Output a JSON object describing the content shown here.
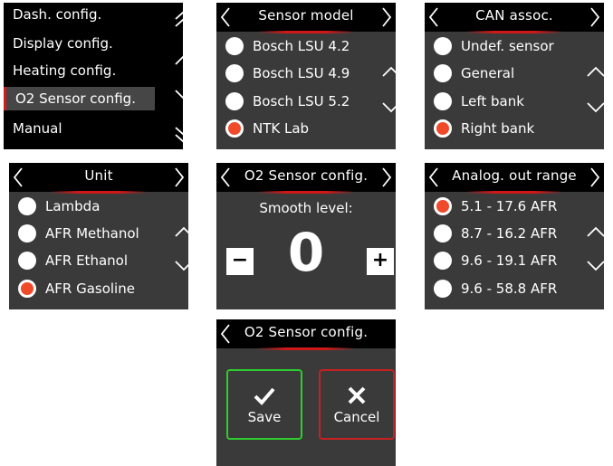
{
  "menu": {
    "items": [
      "Dash. config.",
      "Display config.",
      "Heating config.",
      "O2 Sensor config.",
      "Manual"
    ]
  },
  "sensor_model": {
    "title": "Sensor model",
    "options": [
      "Bosch LSU 4.2",
      "Bosch LSU 4.9",
      "Bosch LSU 5.2",
      "NTK Lab"
    ],
    "selected": "NTK Lab"
  },
  "can_assoc": {
    "title": "CAN assoc.",
    "options": [
      "Undef. sensor",
      "General",
      "Left bank",
      "Right bank"
    ],
    "selected": "Right bank"
  },
  "unit": {
    "title": "Unit",
    "options": [
      "Lambda",
      "AFR Methanol",
      "AFR Ethanol",
      "AFR Gasoline"
    ],
    "selected": "AFR Gasoline"
  },
  "smooth": {
    "title": "O2 Sensor config.",
    "label": "Smooth level:",
    "value": "0",
    "minus": "−",
    "plus": "+"
  },
  "analog_out": {
    "title": "Analog. out range",
    "options": [
      "5.1 - 17.6 AFR",
      "8.7 - 16.2 AFR",
      "9.6 - 19.1 AFR",
      "9.6 - 58.8 AFR"
    ],
    "selected": "5.1 - 17.6 AFR"
  },
  "confirm": {
    "title": "O2 Sensor config.",
    "save_label": "Save",
    "cancel_label": "Cancel"
  },
  "colors": {
    "accent_red": "#d61a1a",
    "selected_radio": "#f04a2a",
    "save_border": "#2ecc2e",
    "cancel_border": "#c62020"
  }
}
